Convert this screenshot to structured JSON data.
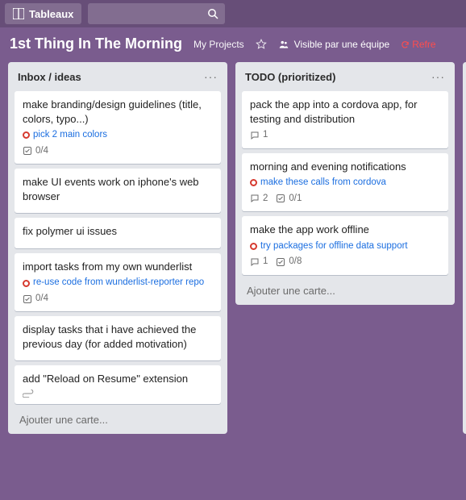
{
  "topbar": {
    "boards_label": "Tableaux"
  },
  "header": {
    "title": "1st Thing In The Morning",
    "my_projects": "My Projects",
    "visibility": "Visible par une équipe",
    "refresh": "Refre"
  },
  "lists": [
    {
      "title": "Inbox / ideas",
      "add_label": "Ajouter une carte...",
      "cards": [
        {
          "title": "make branding/design guidelines (title, colors, typo...)",
          "sublink": "pick 2 main colors",
          "checklist": "0/4"
        },
        {
          "title": "make UI events work on iphone's web browser"
        },
        {
          "title": "fix polymer ui issues"
        },
        {
          "title": "import tasks from my own wunderlist",
          "sublink": "re-use code from wunderlist-reporter repo",
          "checklist": "0/4"
        },
        {
          "title": "display tasks that i have achieved the previous day (for added motivation)"
        },
        {
          "title": "add \"Reload on Resume\" extension",
          "attachment": true
        }
      ]
    },
    {
      "title": "TODO (prioritized)",
      "add_label": "Ajouter une carte...",
      "cards": [
        {
          "title": "pack the app into a cordova app, for testing and distribution",
          "comments": "1"
        },
        {
          "title": "morning and evening notifications",
          "sublink": "make these calls from cordova",
          "comments": "2",
          "checklist": "0/1"
        },
        {
          "title": "make the app work offline",
          "sublink": "try packages for offline data support",
          "comments": "1",
          "checklist": "0/8"
        }
      ]
    }
  ]
}
